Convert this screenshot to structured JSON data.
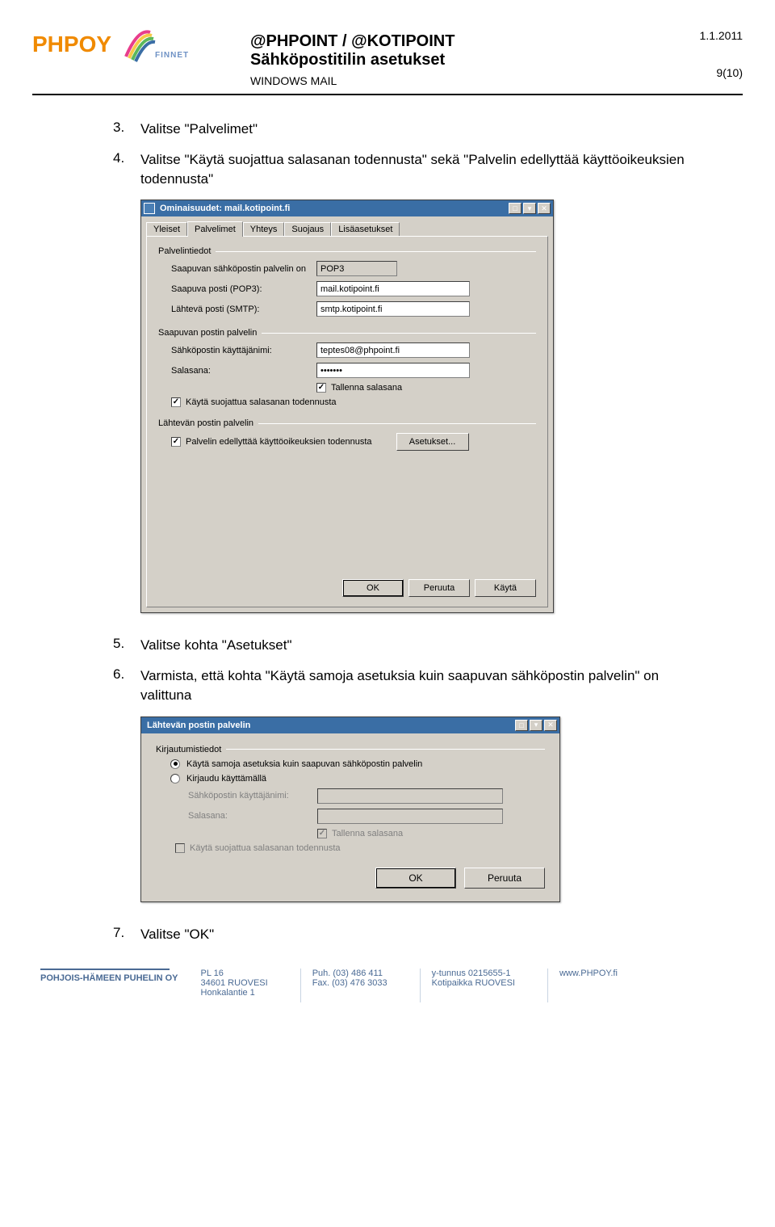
{
  "header": {
    "logo_text": "PHPOY",
    "finnet": "FINNET",
    "title_line1": "@PHPOINT / @KOTIPOINT",
    "title_line2": "Sähköpostitilin asetukset",
    "subtitle": "WINDOWS MAIL",
    "date": "1.1.2011",
    "page": "9(10)"
  },
  "steps": {
    "s3": {
      "num": "3.",
      "text": "Valitse \"Palvelimet\""
    },
    "s4": {
      "num": "4.",
      "text": "Valitse \"Käytä suojattua salasanan todennusta\" sekä \"Palvelin edellyttää käyttöoikeuksien todennusta\""
    },
    "s5": {
      "num": "5.",
      "text": "Valitse kohta \"Asetukset\""
    },
    "s6": {
      "num": "6.",
      "text": "Varmista, että kohta \"Käytä samoja asetuksia kuin saapuvan sähköpostin palvelin\" on valittuna"
    },
    "s7": {
      "num": "7.",
      "text": "Valitse \"OK\""
    }
  },
  "dialog1": {
    "title": "Ominaisuudet: mail.kotipoint.fi",
    "tabs": [
      "Yleiset",
      "Palvelimet",
      "Yhteys",
      "Suojaus",
      "Lisäasetukset"
    ],
    "group_palvelintiedot": "Palvelintiedot",
    "lbl_server_type": "Saapuvan sähköpostin palvelin on",
    "val_server_type": "POP3",
    "lbl_pop3": "Saapuva posti (POP3):",
    "val_pop3": "mail.kotipoint.fi",
    "lbl_smtp": "Lähtevä posti (SMTP):",
    "val_smtp": "smtp.kotipoint.fi",
    "group_incoming": "Saapuvan postin palvelin",
    "lbl_user": "Sähköpostin käyttäjänimi:",
    "val_user": "teptes08@phpoint.fi",
    "lbl_pass": "Salasana:",
    "val_pass": "•••••••",
    "chk_remember": "Tallenna salasana",
    "chk_secure": "Käytä suojattua salasanan todennusta",
    "group_outgoing": "Lähtevän postin palvelin",
    "chk_outauth": "Palvelin edellyttää käyttöoikeuksien todennusta",
    "btn_settings": "Asetukset...",
    "btn_ok": "OK",
    "btn_cancel": "Peruuta",
    "btn_apply": "Käytä"
  },
  "dialog2": {
    "title": "Lähtevän postin palvelin",
    "group": "Kirjautumistiedot",
    "radio_same": "Käytä samoja asetuksia kuin saapuvan sähköpostin palvelin",
    "radio_login": "Kirjaudu käyttämällä",
    "lbl_user": "Sähköpostin käyttäjänimi:",
    "lbl_pass": "Salasana:",
    "chk_remember": "Tallenna salasana",
    "chk_secure": "Käytä suojattua salasanan todennusta",
    "btn_ok": "OK",
    "btn_cancel": "Peruuta"
  },
  "footer": {
    "company": "POHJOIS-HÄMEEN PUHELIN OY",
    "addr1": "PL 16",
    "addr2": "34601 RUOVESI",
    "addr3": "Honkalantie 1",
    "tel1": "Puh. (03) 486 411",
    "tel2": "Fax.  (03) 476 3033",
    "reg1": "y-tunnus 0215655-1",
    "reg2": "Kotipaikka RUOVESI",
    "web": "www.PHPOY.fi"
  }
}
